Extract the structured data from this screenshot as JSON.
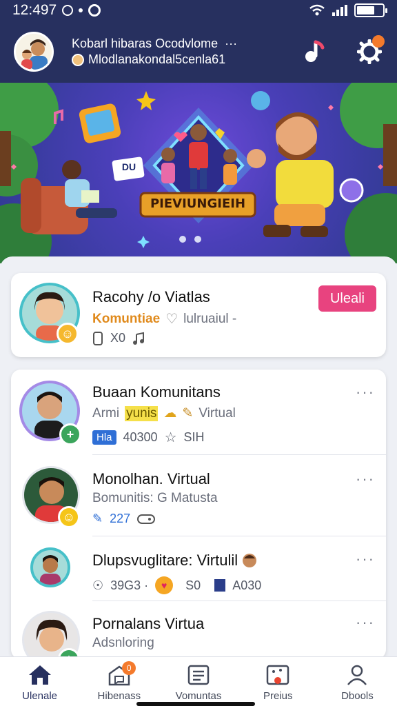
{
  "status": {
    "time": "12:497"
  },
  "header": {
    "title": "Kobarl hibaras Ocodvlome",
    "title_more": "···",
    "subtitle": "Mlodlanakondal5cenla61"
  },
  "banner": {
    "title": "PIEVIUNGIEIH",
    "sign_label": "DU"
  },
  "featured": {
    "name": "Racohy /o Viatlas",
    "category": "Komuntiae",
    "status": "lulruaiul -",
    "members": "X0",
    "join_label": "Uleali"
  },
  "list": [
    {
      "name": "Buaan Komunitans",
      "sub_a": "Armi",
      "sub_highlight": "yunis",
      "sub_b": "Virtual",
      "tag": "Hla",
      "count": "40300",
      "rating": "SIH"
    },
    {
      "name": "Monolhan. Virtual",
      "sub": "Bomunitis: G Matusta",
      "count": "227"
    },
    {
      "name": "Dlupsvuglitare: Virtulil",
      "count_a": "39G3 ·",
      "count_b": "S0",
      "count_c": "A030"
    },
    {
      "name": "Pornalans Virtua",
      "sub": "Adsnloring"
    }
  ],
  "more_label": "···",
  "nav": [
    {
      "label": "Ulenale"
    },
    {
      "label": "Hibenass",
      "badge": "0"
    },
    {
      "label": "Vomuntas"
    },
    {
      "label": "Preius"
    },
    {
      "label": "Dbools"
    }
  ],
  "colors": {
    "header_bg": "#27305f",
    "accent_pink": "#e8437f",
    "accent_orange": "#f47a2c"
  }
}
